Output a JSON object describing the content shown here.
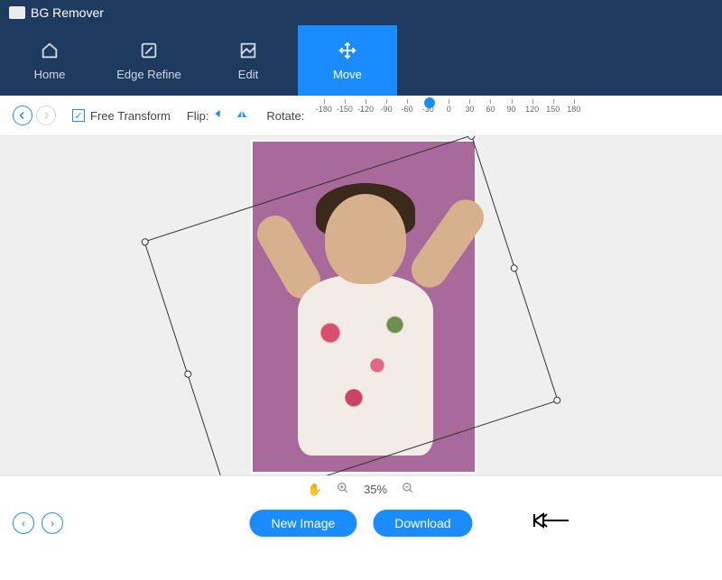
{
  "app": {
    "title": "BG Remover"
  },
  "tabs": [
    {
      "id": "home",
      "label": "Home",
      "icon": "home-icon"
    },
    {
      "id": "edge",
      "label": "Edge Refine",
      "icon": "edge-refine-icon"
    },
    {
      "id": "edit",
      "label": "Edit",
      "icon": "edit-icon"
    },
    {
      "id": "move",
      "label": "Move",
      "icon": "move-icon",
      "active": true
    }
  ],
  "toolbar": {
    "free_transform_label": "Free Transform",
    "free_transform_checked": true,
    "flip_label": "Flip:",
    "rotate_label": "Rotate:",
    "rotate_ticks": [
      "-180",
      "-150",
      "-120",
      "-90",
      "-60",
      "-30",
      "0",
      "30",
      "60",
      "90",
      "120",
      "150",
      "180"
    ],
    "rotate_value": -30
  },
  "canvas": {
    "bg_color": "#a86a9b",
    "transform_rotation_deg": -18
  },
  "zoom": {
    "level_text": "35%"
  },
  "footer": {
    "new_image_label": "New Image",
    "download_label": "Download"
  }
}
